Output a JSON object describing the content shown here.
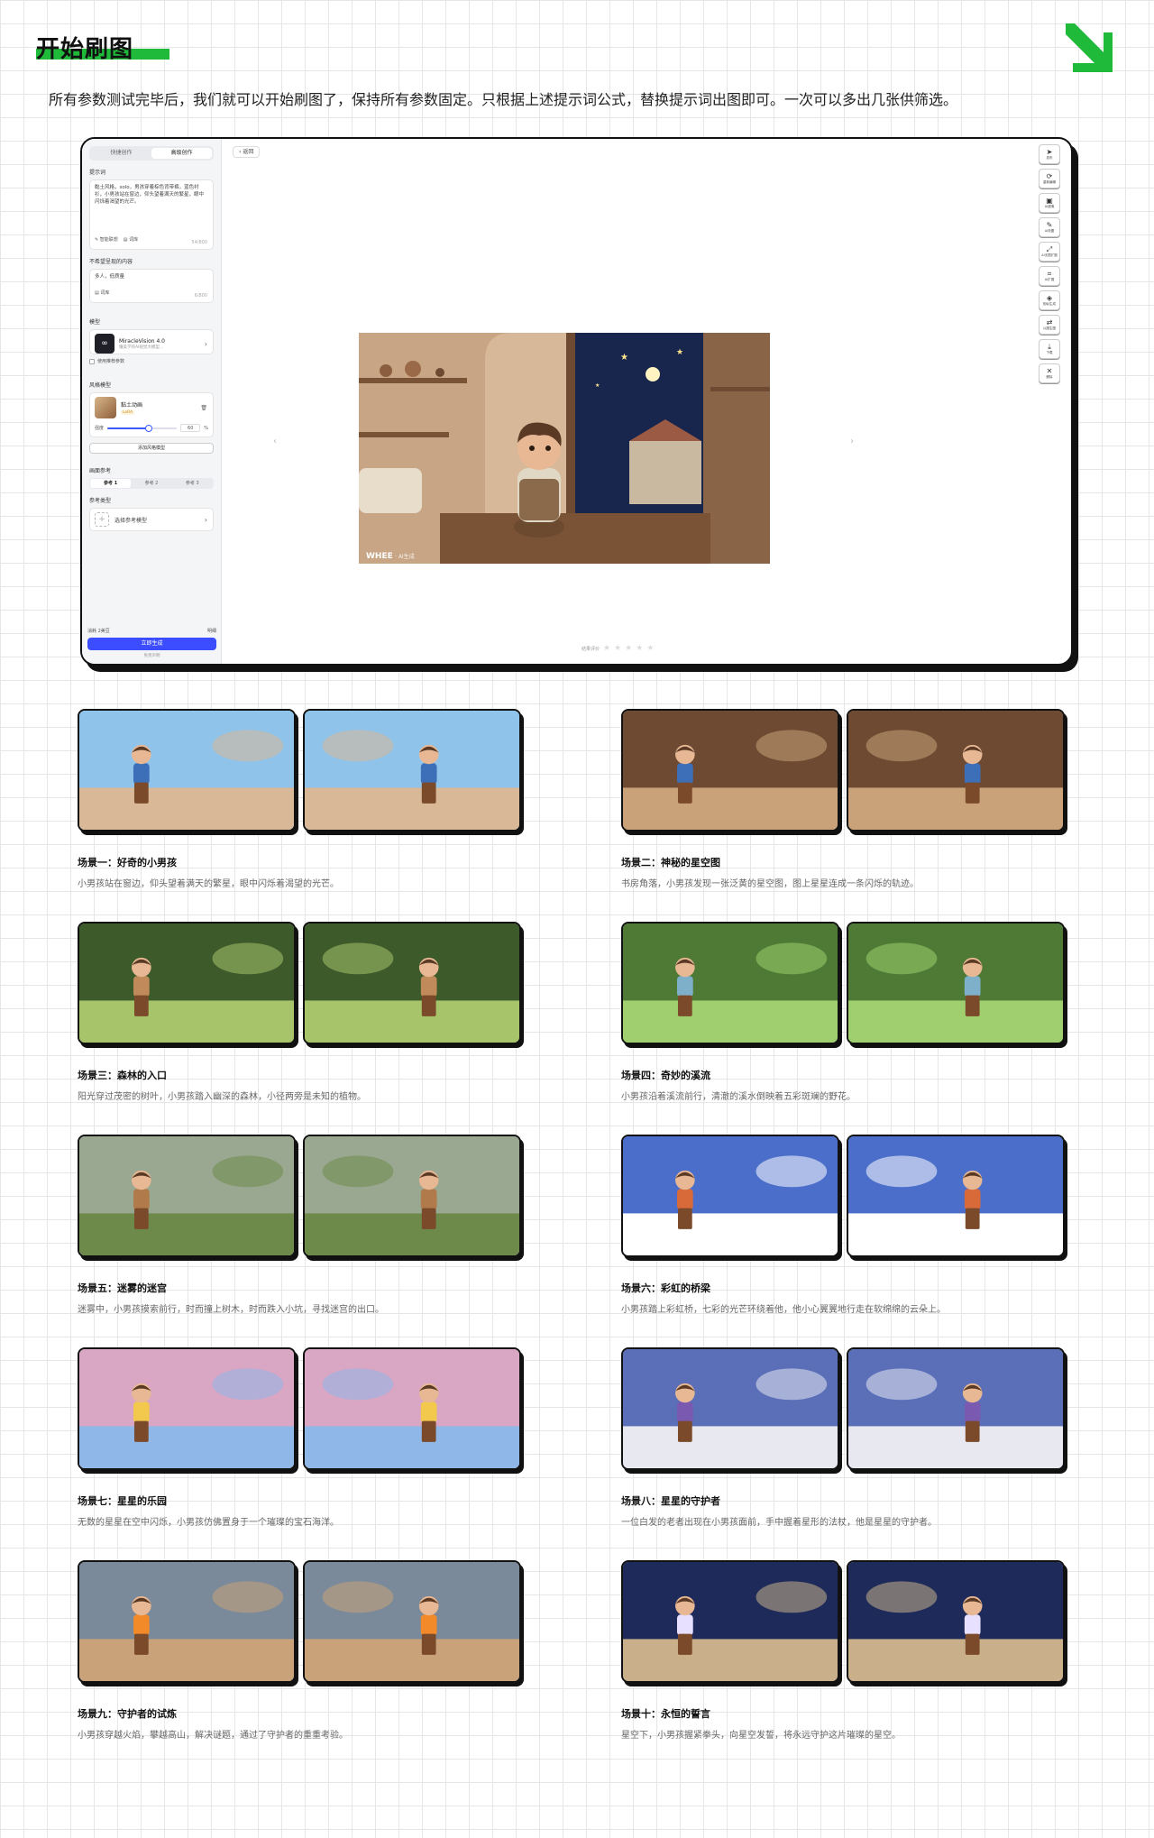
{
  "header": {
    "title": "开始刷图",
    "intro": "所有参数测试完毕后，我们就可以开始刷图了，保持所有参数固定。只根据上述提示词公式，替换提示词出图即可。一次可以多出几张供筛选。",
    "accent_color": "#1fba3a",
    "arrow_icon": "arrow-down-right-icon"
  },
  "app": {
    "tabs": [
      "快捷创作",
      "高级创作"
    ],
    "active_tab": 1,
    "prompt_label": "提示词",
    "prompt_text": "黏土风格，solo，男孩穿着棕色背带裤，蓝色衬衫，小男孩站在窗边，仰头望着满天的繁星，眼中闪烁着渴望的光芒。",
    "prompt_tools": [
      "智能联想",
      "词库"
    ],
    "prompt_count": "54/800",
    "negative_label": "不希望呈现的内容",
    "negative_text": "多人，低质量",
    "negative_tool": "词库",
    "negative_count": "6/800",
    "model_label": "模型",
    "model_name": "MiracleVision 4.0",
    "model_desc": "懂美学的AI视觉大模型...",
    "recommend_label": "使用推荐参数",
    "style_label": "风格模型",
    "style_name": "黏土动画",
    "style_tag": "LoRA",
    "strength_label": "强度",
    "strength_value": "60",
    "strength_unit": "%",
    "strength_fraction": 0.6,
    "add_style_button": "添加风格模型",
    "ref_label": "画面参考",
    "ref_tabs": [
      "参考 1",
      "参考 2",
      "参考 3"
    ],
    "ref_type_label": "参考类型",
    "ref_select": "选择参考模型",
    "cost_label": "消耗 2美豆",
    "cost_right": "明细",
    "generate_button": "立即生成",
    "disclaimer": "免责声明",
    "back_button": "返回",
    "watermark": "WHEE",
    "watermark_sub": "AI生成",
    "rating_label": "结果评价",
    "toolbar": [
      {
        "icon": "send-icon",
        "glyph": "➤",
        "label": "发布"
      },
      {
        "icon": "redraw-icon",
        "glyph": "⟳",
        "label": "重新编辑"
      },
      {
        "icon": "upscale-icon",
        "glyph": "▣",
        "label": "AI超清"
      },
      {
        "icon": "eraser-icon",
        "glyph": "✎",
        "label": "AI改图"
      },
      {
        "icon": "expand-icon",
        "glyph": "⤢",
        "label": "AI无限扩图"
      },
      {
        "icon": "crop-icon",
        "glyph": "⌗",
        "label": "AI扩展"
      },
      {
        "icon": "variation-icon",
        "glyph": "◈",
        "label": "相似生成"
      },
      {
        "icon": "image-to-image-icon",
        "glyph": "⇄",
        "label": "以图生图"
      },
      {
        "icon": "download-icon",
        "glyph": "⤓",
        "label": "下载"
      },
      {
        "icon": "delete-icon",
        "glyph": "✕",
        "label": "删除"
      }
    ]
  },
  "scenes": [
    {
      "title": "场景一：好奇的小男孩",
      "desc": "小男孩站在窗边，仰头望着满天的繁星，眼中闪烁着渴望的光芒。",
      "palette": [
        "#8fc3ea",
        "#d8b896",
        "#3d6fb8"
      ]
    },
    {
      "title": "场景二：神秘的星空图",
      "desc": "书房角落，小男孩发现一张泛黄的星空图，图上星星连成一条闪烁的轨迹。",
      "palette": [
        "#6e4a32",
        "#c9a27a",
        "#3d6fb8"
      ]
    },
    {
      "title": "场景三：森林的入口",
      "desc": "阳光穿过茂密的树叶，小男孩踏入幽深的森林，小径两旁是未知的植物。",
      "palette": [
        "#3c5a2a",
        "#a7c46b",
        "#c08a5a"
      ]
    },
    {
      "title": "场景四：奇妙的溪流",
      "desc": "小男孩沿着溪流前行，清澈的溪水倒映着五彩斑斓的野花。",
      "palette": [
        "#4f7a36",
        "#9fcf6e",
        "#7fb0c9"
      ]
    },
    {
      "title": "场景五：迷雾的迷宫",
      "desc": "迷雾中，小男孩摸索前行，时而撞上树木，时而跌入小坑，寻找迷宫的出口。",
      "palette": [
        "#9aa892",
        "#6e8a4a",
        "#b07a4a"
      ]
    },
    {
      "title": "场景六：彩虹的桥梁",
      "desc": "小男孩踏上彩虹桥，七彩的光芒环绕着他，他小心翼翼地行走在软绵绵的云朵上。",
      "palette": [
        "#4a6ec9",
        "#ffffff",
        "#d86a3a"
      ]
    },
    {
      "title": "场景七：星星的乐园",
      "desc": "无数的星星在空中闪烁，小男孩仿佛置身于一个璀璨的宝石海洋。",
      "palette": [
        "#d9a6c4",
        "#8fb7e8",
        "#f2c94c"
      ]
    },
    {
      "title": "场景八：星星的守护者",
      "desc": "一位白发的老者出现在小男孩面前，手中握着星形的法杖，他是星星的守护者。",
      "palette": [
        "#5a6fb8",
        "#e8e8f0",
        "#7a5ab0"
      ]
    },
    {
      "title": "场景九：守护者的试炼",
      "desc": "小男孩穿越火焰，攀越高山，解决谜题，通过了守护者的重重考验。",
      "palette": [
        "#7a8a9a",
        "#c9a27a",
        "#f28a2a"
      ]
    },
    {
      "title": "场景十：永恒的誓言",
      "desc": "星空下，小男孩握紧拳头，向星空发誓，将永远守护这片璀璨的星空。",
      "palette": [
        "#1e2a5a",
        "#c9b08a",
        "#e8e0ff"
      ]
    }
  ]
}
